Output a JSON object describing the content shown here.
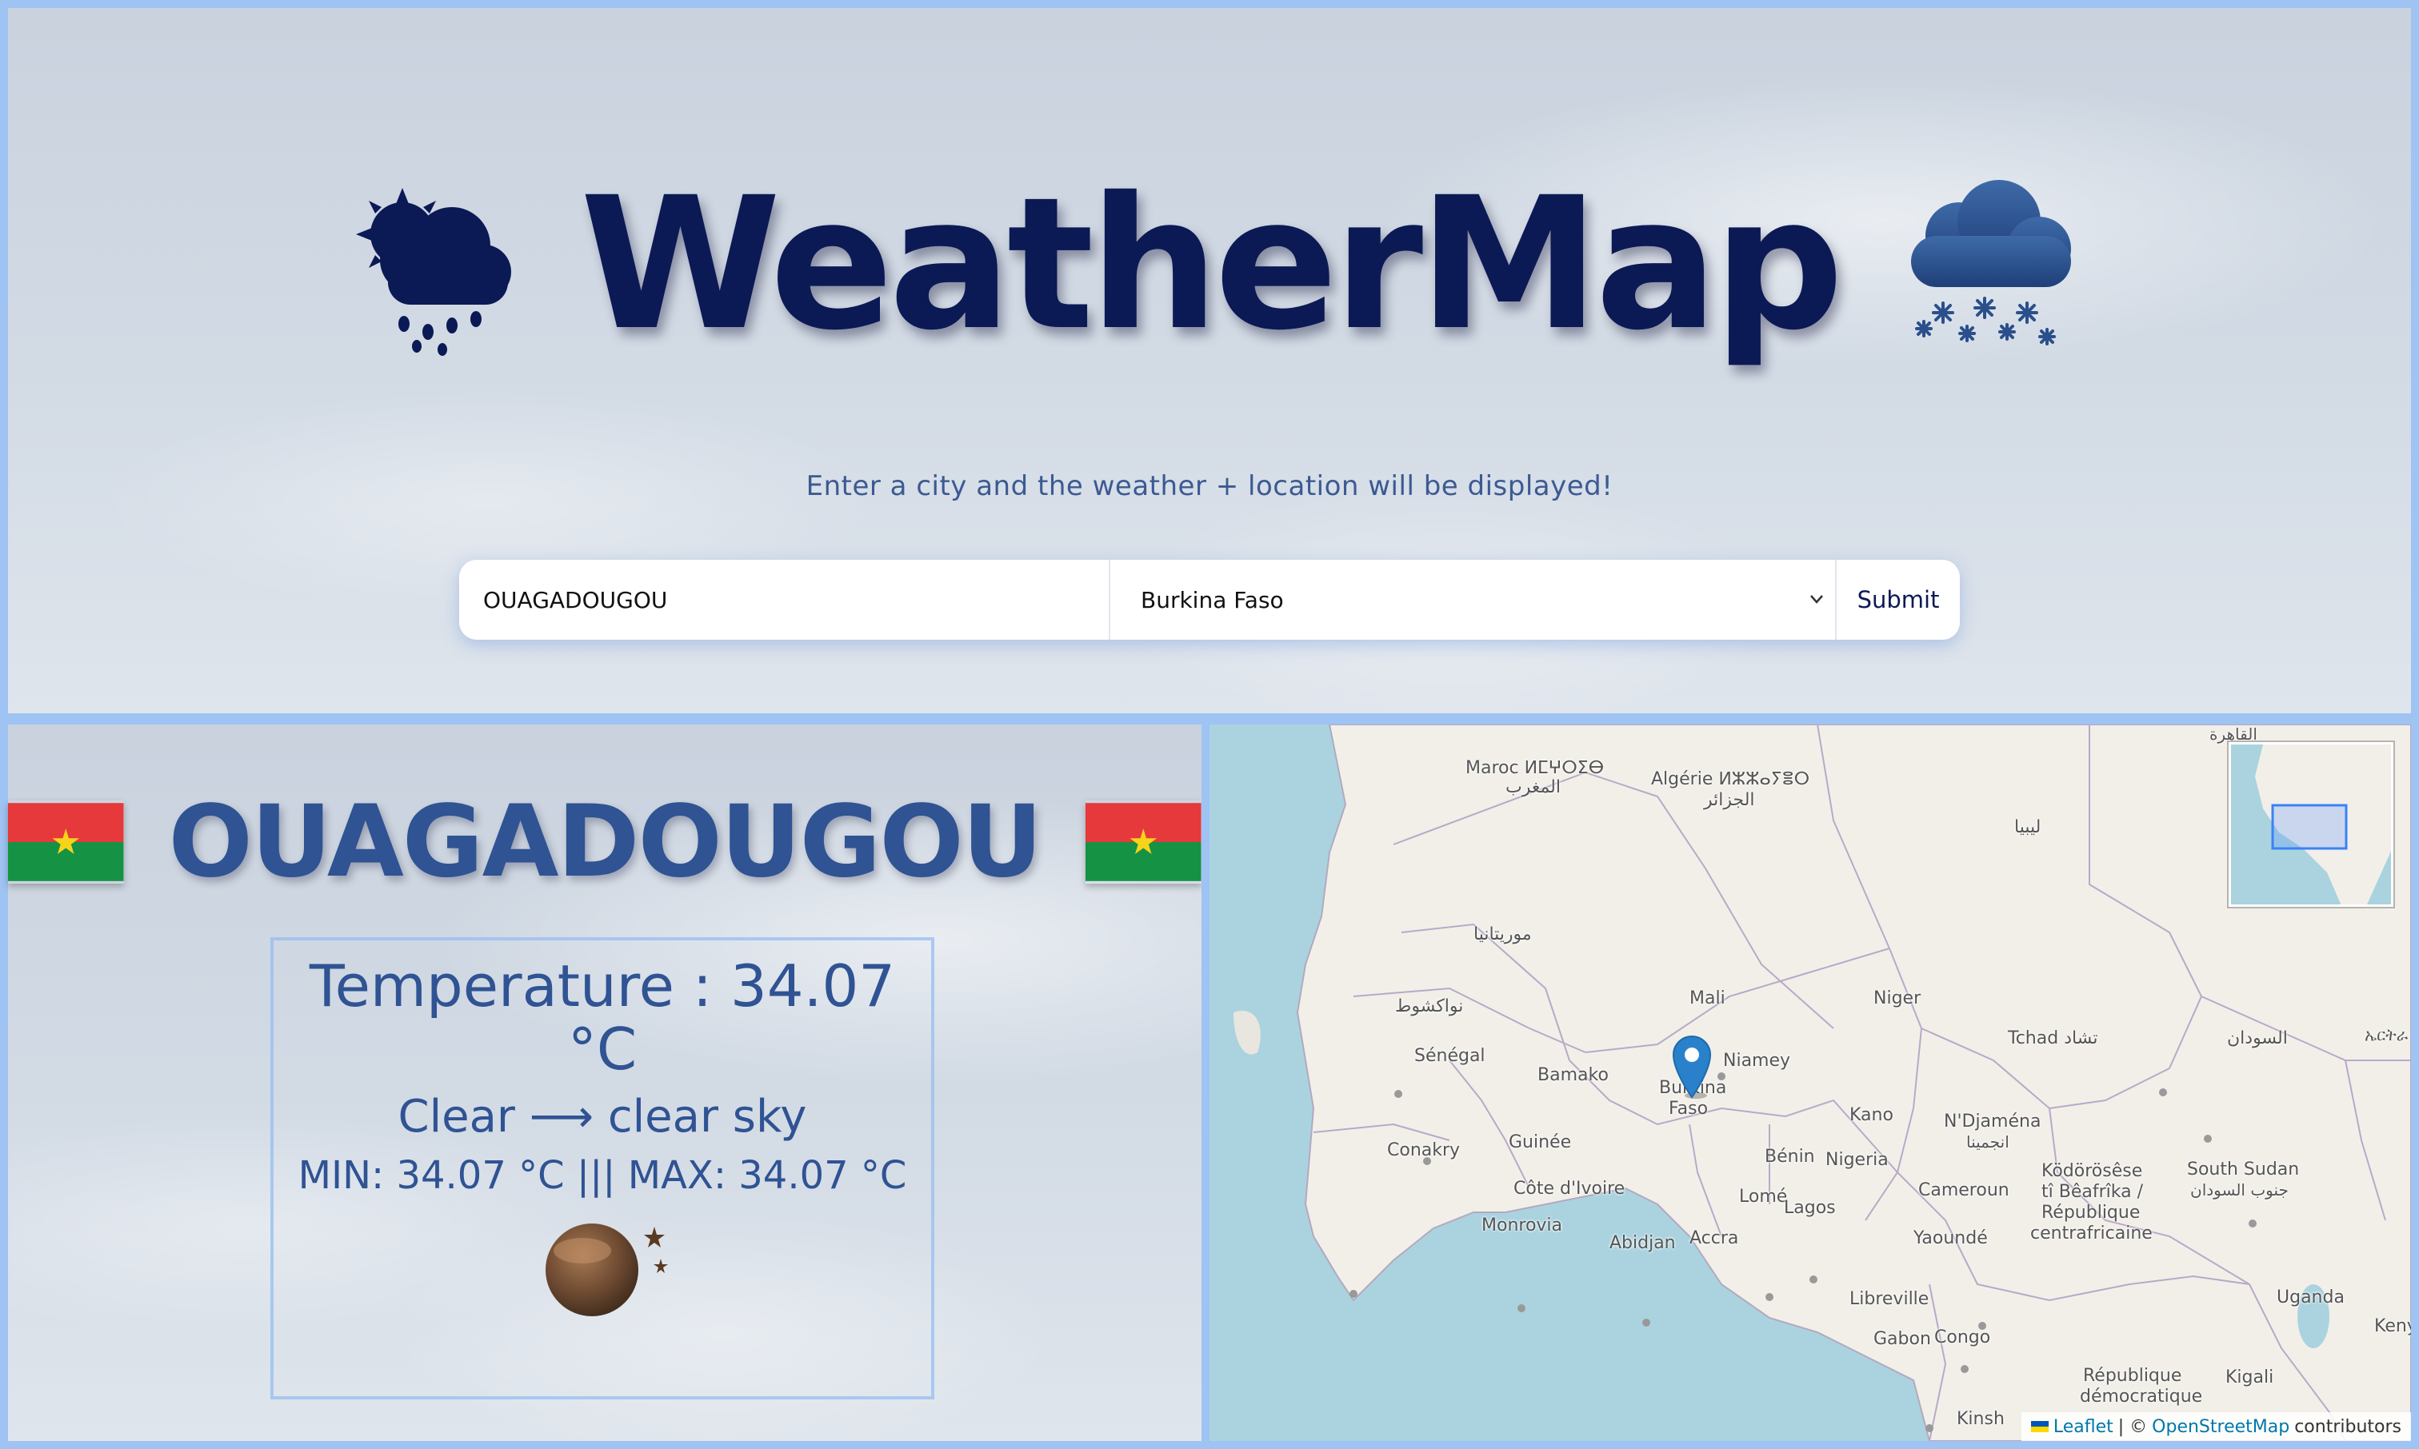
{
  "header": {
    "title": "WeatherMap",
    "left_icon": "sun-behind-rain-cloud-icon",
    "right_icon": "snow-cloud-icon",
    "subtitle": "Enter a city and the weather + location will be displayed!"
  },
  "search": {
    "city_value": "OUAGADOUGOU",
    "country_selected": "Burkina Faso",
    "submit_label": "Submit"
  },
  "weather": {
    "city": "OUAGADOUGOU",
    "flag_icon": "burkina-faso-flag-icon",
    "temperature": "Temperature : 34.07 °C",
    "description": "Clear ⟶ clear sky",
    "minmax": "MIN: 34.07 °C ||| MAX: 34.07 °C",
    "condition_icon": "clear-night-moon-icon"
  },
  "map": {
    "labels": {
      "maroc": "Maroc ⵍⵎⵖⵔⵉⴱ",
      "maroc_ar": "المغرب",
      "algerie": "Algérie ⵍⵣⵣⴰⵢⴻⵔ",
      "algerie_ar": "الجزائر",
      "cairo": "القاهرة",
      "libya": "ليبيا",
      "mauritania": "موريتانيا",
      "nouakchott": "نواكشوط",
      "mali": "Mali",
      "niger": "Niger",
      "tchad": "Tchad تشاد",
      "sudan": "السودان",
      "eritrea": "ኤርትራ",
      "senegal": "Sénégal",
      "bamako": "Bamako",
      "niamey": "Niamey",
      "burkina": "Burkina",
      "faso": "Faso",
      "kano": "Kano",
      "ndjamena": "N'Djaména",
      "ndjamena_ar": "انجمينا",
      "conakry": "Conakry",
      "guinee": "Guinée",
      "benin": "Bénin",
      "nigeria": "Nigeria",
      "cote_divoire": "Côte d'Ivoire",
      "lome": "Lomé",
      "lagos": "Lagos",
      "cameroun": "Cameroun",
      "car1": "Ködörösêse",
      "car2": "tî Bêafrîka /",
      "car3": "République",
      "car4": "centrafricaine",
      "south_sudan": "South Sudan",
      "south_sudan_ar": "جنوب السودان",
      "monrovia": "Monrovia",
      "abidjan": "Abidjan",
      "accra": "Accra",
      "yaounde": "Yaoundé",
      "libreville": "Libreville",
      "gabon": "Gabon",
      "congo": "Congo",
      "uganda": "Uganda",
      "kenya": "Keny",
      "rdc1": "République",
      "rdc2": "démocratique",
      "kigali": "Kigali",
      "kinshasa": "Kinsh"
    },
    "attribution": {
      "leaflet": "Leaflet",
      "sep": "| ©",
      "osm": "OpenStreetMap",
      "contributors": "contributors"
    },
    "marker_icon": "map-marker-icon"
  }
}
